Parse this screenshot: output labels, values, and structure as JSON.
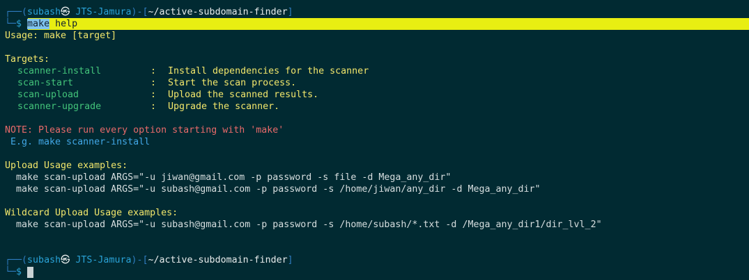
{
  "prompt1": {
    "corner": "┌──",
    "open": "(",
    "user": "subash",
    "at": "㉿",
    "host": "JTS-Jamura",
    "close": ")-[",
    "path": "~/active-subdomain-finder",
    "end": "]",
    "corner2": "└─",
    "dollar": "$",
    "command_token": "make",
    "command_arg": " help"
  },
  "output": {
    "usage": "Usage: make [target]",
    "targets_heading": "Targets:",
    "targets": [
      {
        "name": "scanner-install",
        "sep": ":",
        "desc": "Install dependencies for the scanner"
      },
      {
        "name": "scan-start",
        "sep": ":",
        "desc": "Start the scan process."
      },
      {
        "name": "scan-upload",
        "sep": ":",
        "desc": "Upload the scanned results."
      },
      {
        "name": "scanner-upgrade",
        "sep": ":",
        "desc": "Upgrade the scanner."
      }
    ],
    "note": "NOTE: Please run every option starting with 'make'",
    "example": " E.g. make scanner-install",
    "upload_heading": "Upload Usage examples:",
    "upload_examples": [
      "  make scan-upload ARGS=\"-u jiwan@gmail.com -p password -s file -d Mega_any_dir\"",
      "  make scan-upload ARGS=\"-u subash@gmail.com -p password -s /home/jiwan/any_dir -d Mega_any_dir\""
    ],
    "wildcard_heading": "Wildcard Upload Usage examples:",
    "wildcard_examples": [
      "  make scan-upload ARGS=\"-u subash@gmail.com -p password -s /home/subash/*.txt -d /Mega_any_dir1/dir_lvl_2\""
    ]
  },
  "prompt2": {
    "corner": "┌──",
    "open": "(",
    "user": "subash",
    "at": "㉿",
    "host": "JTS-Jamura",
    "close": ")-[",
    "path": "~/active-subdomain-finder",
    "end": "]",
    "corner2": "└─",
    "dollar": "$"
  }
}
